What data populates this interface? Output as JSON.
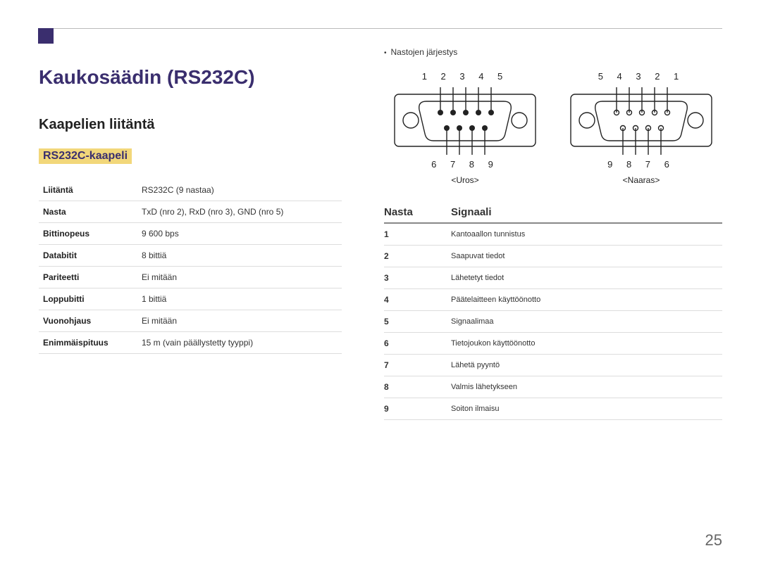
{
  "page_number": "25",
  "heading": "Kaukosäädin (RS232C)",
  "subheading": "Kaapelien liitäntä",
  "highlight": "RS232C-kaapeli",
  "spec_table": [
    {
      "label": "Liitäntä",
      "value": "RS232C (9 nastaa)"
    },
    {
      "label": "Nasta",
      "value": "TxD (nro 2), RxD (nro 3), GND (nro 5)"
    },
    {
      "label": "Bittinopeus",
      "value": "9 600 bps"
    },
    {
      "label": "Databitit",
      "value": "8 bittiä"
    },
    {
      "label": "Pariteetti",
      "value": "Ei mitään"
    },
    {
      "label": "Loppubitti",
      "value": "1 bittiä"
    },
    {
      "label": "Vuonohjaus",
      "value": "Ei mitään"
    },
    {
      "label": "Enimmäispituus",
      "value": "15 m (vain päällystetty tyyppi)"
    }
  ],
  "pin_note": "Nastojen järjestys",
  "connectors": {
    "male": {
      "top_pins": "1 2 3 4 5",
      "bottom_pins": "6 7 8 9",
      "label": "<Uros>"
    },
    "female": {
      "top_pins": "5 4 3 2 1",
      "bottom_pins": "9 8 7 6",
      "label": "<Naaras>"
    }
  },
  "signal_header": {
    "col1": "Nasta",
    "col2": "Signaali"
  },
  "signals": [
    {
      "pin": "1",
      "name": "Kantoaallon tunnistus"
    },
    {
      "pin": "2",
      "name": "Saapuvat tiedot"
    },
    {
      "pin": "3",
      "name": "Lähetetyt tiedot"
    },
    {
      "pin": "4",
      "name": "Päätelaitteen käyttöönotto"
    },
    {
      "pin": "5",
      "name": "Signaalimaa"
    },
    {
      "pin": "6",
      "name": "Tietojoukon käyttöönotto"
    },
    {
      "pin": "7",
      "name": "Lähetä pyyntö"
    },
    {
      "pin": "8",
      "name": "Valmis lähetykseen"
    },
    {
      "pin": "9",
      "name": "Soiton ilmaisu"
    }
  ]
}
